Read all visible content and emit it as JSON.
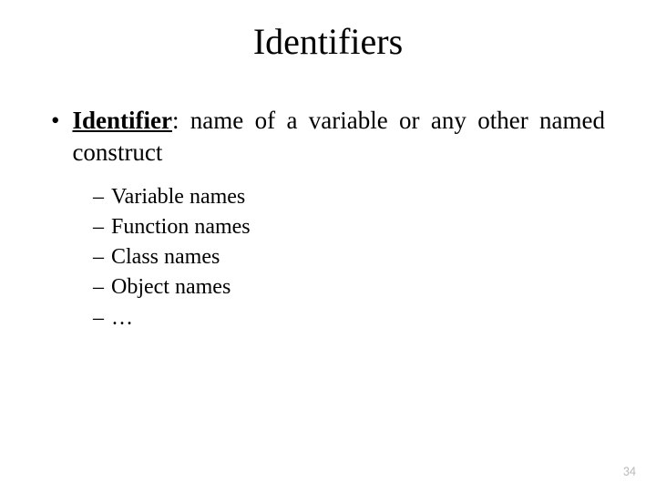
{
  "title": "Identifiers",
  "main_bullet": {
    "label": "Identifier",
    "colon": ":",
    "definition": " name of a variable or any other named construct"
  },
  "sub_bullets": [
    "Variable names",
    "Function names",
    "Class names",
    "Object names",
    "…"
  ],
  "page_number": "34"
}
